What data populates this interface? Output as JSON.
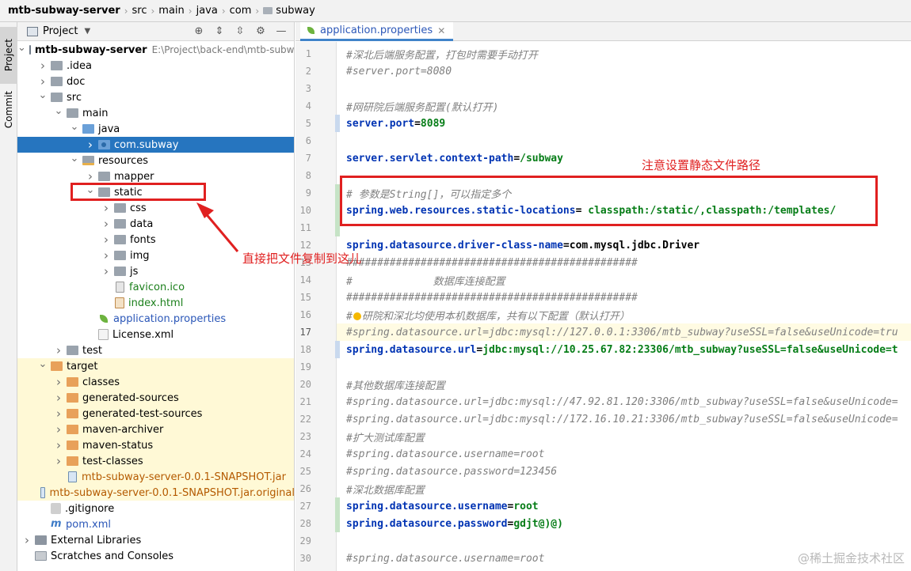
{
  "breadcrumb": [
    "mtb-subway-server",
    "src",
    "main",
    "java",
    "com",
    "subway"
  ],
  "toolstrip": {
    "project_label": "Project",
    "commit_label": "Commit"
  },
  "project_panel": {
    "title": "Project"
  },
  "tree": [
    {
      "depth": 0,
      "expand": "open",
      "icon": "module",
      "label": "mtb-subway-server",
      "path": "E:\\Project\\back-end\\mtb-subwa",
      "style": "bold"
    },
    {
      "depth": 1,
      "expand": "closed",
      "icon": "folder-gray",
      "label": ".idea"
    },
    {
      "depth": 1,
      "expand": "closed",
      "icon": "folder-gray",
      "label": "doc"
    },
    {
      "depth": 1,
      "expand": "open",
      "icon": "folder-gray",
      "label": "src"
    },
    {
      "depth": 2,
      "expand": "open",
      "icon": "folder-gray",
      "label": "main"
    },
    {
      "depth": 3,
      "expand": "open",
      "icon": "folder-blue",
      "label": "java"
    },
    {
      "depth": 4,
      "expand": "closed",
      "icon": "pkg",
      "label": "com.subway",
      "selected": true
    },
    {
      "depth": 3,
      "expand": "open",
      "icon": "folder-res",
      "label": "resources"
    },
    {
      "depth": 4,
      "expand": "closed",
      "icon": "folder-gray",
      "label": "mapper"
    },
    {
      "depth": 4,
      "expand": "open",
      "icon": "folder-gray",
      "label": "static"
    },
    {
      "depth": 5,
      "expand": "closed",
      "icon": "folder-gray",
      "label": "css"
    },
    {
      "depth": 5,
      "expand": "closed",
      "icon": "folder-gray",
      "label": "data"
    },
    {
      "depth": 5,
      "expand": "closed",
      "icon": "folder-gray",
      "label": "fonts"
    },
    {
      "depth": 5,
      "expand": "closed",
      "icon": "folder-gray",
      "label": "img"
    },
    {
      "depth": 5,
      "expand": "closed",
      "icon": "folder-gray",
      "label": "js"
    },
    {
      "depth": 5,
      "expand": "none",
      "icon": "file",
      "label": "favicon.ico",
      "style": "green"
    },
    {
      "depth": 5,
      "expand": "none",
      "icon": "html",
      "label": "index.html",
      "style": "green"
    },
    {
      "depth": 4,
      "expand": "none",
      "icon": "leaf",
      "label": "application.properties",
      "style": "blue"
    },
    {
      "depth": 4,
      "expand": "none",
      "icon": "xml",
      "label": "License.xml"
    },
    {
      "depth": 2,
      "expand": "closed",
      "icon": "folder-gray",
      "label": "test"
    },
    {
      "depth": 1,
      "expand": "open",
      "icon": "folder-orange",
      "label": "target",
      "excluded": true
    },
    {
      "depth": 2,
      "expand": "closed",
      "icon": "folder-orange",
      "label": "classes",
      "excluded": true
    },
    {
      "depth": 2,
      "expand": "closed",
      "icon": "folder-orange",
      "label": "generated-sources",
      "excluded": true
    },
    {
      "depth": 2,
      "expand": "closed",
      "icon": "folder-orange",
      "label": "generated-test-sources",
      "excluded": true
    },
    {
      "depth": 2,
      "expand": "closed",
      "icon": "folder-orange",
      "label": "maven-archiver",
      "excluded": true
    },
    {
      "depth": 2,
      "expand": "closed",
      "icon": "folder-orange",
      "label": "maven-status",
      "excluded": true
    },
    {
      "depth": 2,
      "expand": "closed",
      "icon": "folder-orange",
      "label": "test-classes",
      "excluded": true
    },
    {
      "depth": 2,
      "expand": "none",
      "icon": "jar",
      "label": "mtb-subway-server-0.0.1-SNAPSHOT.jar",
      "style": "orange",
      "excluded": true
    },
    {
      "depth": 2,
      "expand": "none",
      "icon": "jar",
      "label": "mtb-subway-server-0.0.1-SNAPSHOT.jar.original",
      "style": "orange",
      "excluded": true
    },
    {
      "depth": 1,
      "expand": "none",
      "icon": "ignore",
      "label": ".gitignore"
    },
    {
      "depth": 1,
      "expand": "none",
      "icon": "maven",
      "label": "pom.xml",
      "style": "blue"
    },
    {
      "depth": 0,
      "expand": "closed",
      "icon": "libs",
      "label": "External Libraries"
    },
    {
      "depth": 0,
      "expand": "none",
      "icon": "scratch",
      "label": "Scratches and Consoles"
    }
  ],
  "editor": {
    "tab_label": "application.properties",
    "lines": [
      {
        "n": "1",
        "type": "comment",
        "text": "#深北后端服务配置，打包时需要手动打开"
      },
      {
        "n": "2",
        "type": "comment",
        "text": "#server.port=8080"
      },
      {
        "n": "3",
        "type": "blank",
        "text": ""
      },
      {
        "n": "4",
        "type": "comment",
        "text": "#网研院后端服务配置(默认打开)"
      },
      {
        "n": "5",
        "type": "prop",
        "key": "server.port",
        "value": "8089",
        "mark": "blue"
      },
      {
        "n": "6",
        "type": "blank",
        "text": ""
      },
      {
        "n": "7",
        "type": "prop",
        "key": "server.servlet.context-path",
        "value": "/subway"
      },
      {
        "n": "8",
        "type": "blank",
        "text": ""
      },
      {
        "n": "9",
        "type": "comment",
        "text": "# 参数是String[]，可以指定多个",
        "mark": "green"
      },
      {
        "n": "10",
        "type": "prop",
        "key": "spring.web.resources.static-locations",
        "value": " classpath:/static/,classpath:/templates/",
        "mark": "green"
      },
      {
        "n": "11",
        "type": "blank",
        "text": "",
        "mark": "green"
      },
      {
        "n": "12",
        "type": "prop",
        "key": "spring.datasource.driver-class-name",
        "value": "com.mysql.jdbc.Driver",
        "valstyle": "plain"
      },
      {
        "n": "13",
        "type": "comment",
        "text": "###############################################"
      },
      {
        "n": "14",
        "type": "comment",
        "text": "#             数据库连接配置"
      },
      {
        "n": "15",
        "type": "comment",
        "text": "###############################################"
      },
      {
        "n": "16",
        "type": "comment",
        "text": "#研院和深北均使用本机数据库，共有以下配置（默认打开）",
        "bulb": true
      },
      {
        "n": "17",
        "type": "comment",
        "text": "#spring.datasource.url=jdbc:mysql://127.0.0.1:3306/mtb_subway?useSSL=false&useUnicode=tru",
        "current": true
      },
      {
        "n": "18",
        "type": "prop",
        "key": "spring.datasource.url",
        "value": "jdbc:mysql://10.25.67.82:23306/mtb_subway?useSSL=false&useUnicode=t",
        "mark": "blue"
      },
      {
        "n": "19",
        "type": "blank",
        "text": ""
      },
      {
        "n": "20",
        "type": "comment",
        "text": "#其他数据库连接配置"
      },
      {
        "n": "21",
        "type": "comment",
        "text": "#spring.datasource.url=jdbc:mysql://47.92.81.120:3306/mtb_subway?useSSL=false&useUnicode="
      },
      {
        "n": "22",
        "type": "comment",
        "text": "#spring.datasource.url=jdbc:mysql://172.16.10.21:3306/mtb_subway?useSSL=false&useUnicode="
      },
      {
        "n": "23",
        "type": "comment",
        "text": "#扩大测试库配置"
      },
      {
        "n": "24",
        "type": "comment",
        "text": "#spring.datasource.username=root"
      },
      {
        "n": "25",
        "type": "comment",
        "text": "#spring.datasource.password=123456"
      },
      {
        "n": "26",
        "type": "comment",
        "text": "#深北数据库配置"
      },
      {
        "n": "27",
        "type": "prop",
        "key": "spring.datasource.username",
        "value": "root",
        "mark": "green"
      },
      {
        "n": "28",
        "type": "prop",
        "key": "spring.datasource.password",
        "value": "gdjt@)@)",
        "mark": "green"
      },
      {
        "n": "29",
        "type": "blank",
        "text": ""
      },
      {
        "n": "30",
        "type": "comment",
        "text": "#spring.datasource.username=root"
      }
    ]
  },
  "annotations": {
    "editor_note": "注意设置静态文件路径",
    "tree_note": "直接把文件复制到这儿",
    "accent": "#e02020"
  },
  "watermark": "@稀土掘金技术社区"
}
